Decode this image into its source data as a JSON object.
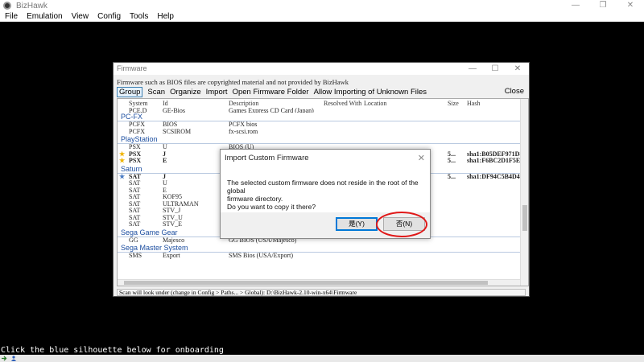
{
  "app": {
    "title": "BizHawk",
    "window_controls": [
      "—",
      "❐",
      "✕"
    ]
  },
  "menubar": [
    "File",
    "Emulation",
    "View",
    "Config",
    "Tools",
    "Help"
  ],
  "console_text": "Click the blue silhouette below for onboarding",
  "firmware_dialog": {
    "title": "Firmware",
    "window_controls": [
      "—",
      "☐",
      "✕"
    ],
    "notice": "Firmware such as BIOS files are copyrighted material and not provided by BizHawk",
    "toolbar": [
      "Group",
      "Scan",
      "Organize",
      "Import",
      "Open Firmware Folder",
      "Allow Importing of Unknown Files"
    ],
    "close_label": "Close",
    "columns": [
      "System",
      "Id",
      "Description",
      "Resolved With",
      "Location",
      "Size",
      "Hash"
    ],
    "top_partial_row": {
      "system": "PCE.D",
      "id": "GE-Bios",
      "desc": "Games Express CD Card (Japan)"
    },
    "groups": [
      {
        "name": "PC-FX",
        "rows": [
          {
            "system": "PCFX",
            "id": "BIOS",
            "desc": "PCFX bios",
            "star": "",
            "size": "",
            "hash": ""
          },
          {
            "system": "PCFX",
            "id": "SCSIROM",
            "desc": "fx-scsi.rom",
            "star": "",
            "size": "",
            "hash": ""
          }
        ]
      },
      {
        "name": "PlayStation",
        "rows": [
          {
            "system": "PSX",
            "id": "U",
            "desc": "BIOS (U)",
            "star": "",
            "size": "",
            "hash": ""
          },
          {
            "system": "PSX",
            "id": "J",
            "desc": "",
            "star": "yellow",
            "bold": true,
            "size": "5...",
            "hash": "sha1:B05DEF971D8E"
          },
          {
            "system": "PSX",
            "id": "E",
            "desc": "",
            "star": "yellow",
            "bold": true,
            "size": "5...",
            "hash": "sha1:F6BC2D1F5EB6"
          }
        ]
      },
      {
        "name": "Saturn",
        "rows": [
          {
            "system": "SAT",
            "id": "J",
            "desc": "",
            "star": "blue",
            "bold": true,
            "size": "5...",
            "hash": "sha1:DF94C5B4D47E"
          },
          {
            "system": "SAT",
            "id": "U",
            "desc": "",
            "star": "",
            "size": "",
            "hash": ""
          },
          {
            "system": "SAT",
            "id": "E",
            "desc": "",
            "star": "",
            "size": "",
            "hash": ""
          },
          {
            "system": "SAT",
            "id": "KOF95",
            "desc": "",
            "star": "",
            "size": "",
            "hash": ""
          },
          {
            "system": "SAT",
            "id": "ULTRAMAN",
            "desc": "",
            "star": "",
            "size": "",
            "hash": ""
          },
          {
            "system": "SAT",
            "id": "STV_J",
            "desc": "",
            "star": "",
            "size": "",
            "hash": ""
          },
          {
            "system": "SAT",
            "id": "STV_U",
            "desc": "",
            "star": "",
            "size": "",
            "hash": ""
          },
          {
            "system": "SAT",
            "id": "STV_E",
            "desc": "ST-V Bios (E)",
            "star": "",
            "size": "",
            "hash": ""
          }
        ]
      },
      {
        "name": "Sega Game Gear",
        "rows": [
          {
            "system": "GG",
            "id": "Majesco",
            "desc": "GG BIOS (USA/Majesco)",
            "star": "",
            "size": "",
            "hash": ""
          }
        ]
      },
      {
        "name": "Sega Master System",
        "rows": [
          {
            "system": "SMS",
            "id": "Export",
            "desc": "SMS Bios (USA/Export)",
            "star": "",
            "size": "",
            "hash": ""
          }
        ]
      }
    ],
    "status": "Scan will look under (change in Config > Paths... > Global):      D:\\BizHawk-2.10-win-x64\\Firmware"
  },
  "import_dialog": {
    "title": "Import Custom Firmware",
    "message_lines": [
      "The selected custom firmware does not reside in the root of the global",
      "firmware directory.",
      "Do you want to copy it there?"
    ],
    "yes_label": "是(Y)",
    "no_label": "否(N)"
  },
  "colors": {
    "group_header": "#1c4ea0",
    "highlight_ring": "#e01818",
    "default_button_border": "#0078d7"
  }
}
